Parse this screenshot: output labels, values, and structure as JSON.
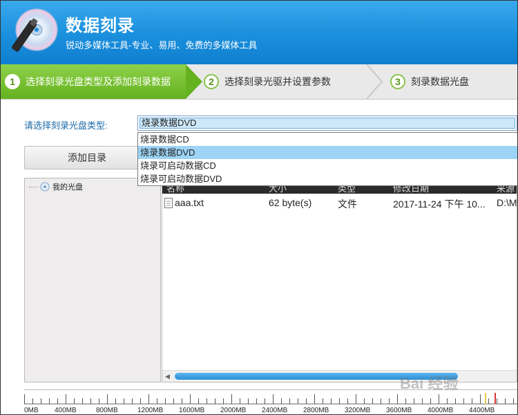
{
  "header": {
    "title": "数据刻录",
    "subtitle": "锐动多媒体工具-专业、易用、免费的多媒体工具",
    "accent_color": "#1a8fdc"
  },
  "steps": [
    {
      "num": "1",
      "label": "选择刻录光盘类型及添加刻录数据",
      "active": true
    },
    {
      "num": "2",
      "label": "选择刻录光驱并设置参数",
      "active": false
    },
    {
      "num": "3",
      "label": "刻录数据光盘",
      "active": false
    }
  ],
  "disc_type": {
    "label": "请选择刻录光盘类型:",
    "selected": "烧录数据DVD",
    "options": [
      "烧录数据CD",
      "烧录数据DVD",
      "烧录可启动数据CD",
      "烧录可启动数据DVD"
    ]
  },
  "left_pane": {
    "add_dir_label": "添加目录",
    "tree_root": "我的光盘"
  },
  "file_table": {
    "columns": [
      "名称",
      "大小",
      "类型",
      "修改日期",
      "来源"
    ],
    "rows": [
      {
        "name": "aaa.txt",
        "size": "62 byte(s)",
        "type": "文件",
        "modified": "2017-11-24 下午 10...",
        "source": "D:\\M"
      }
    ]
  },
  "capacity_ruler": {
    "labels": [
      "0MB",
      "400MB",
      "800MB",
      "1200MB",
      "1600MB",
      "2000MB",
      "2400MB",
      "2800MB",
      "3200MB",
      "3600MB",
      "4000MB",
      "4400MB"
    ]
  },
  "watermark": "Bai 经验"
}
